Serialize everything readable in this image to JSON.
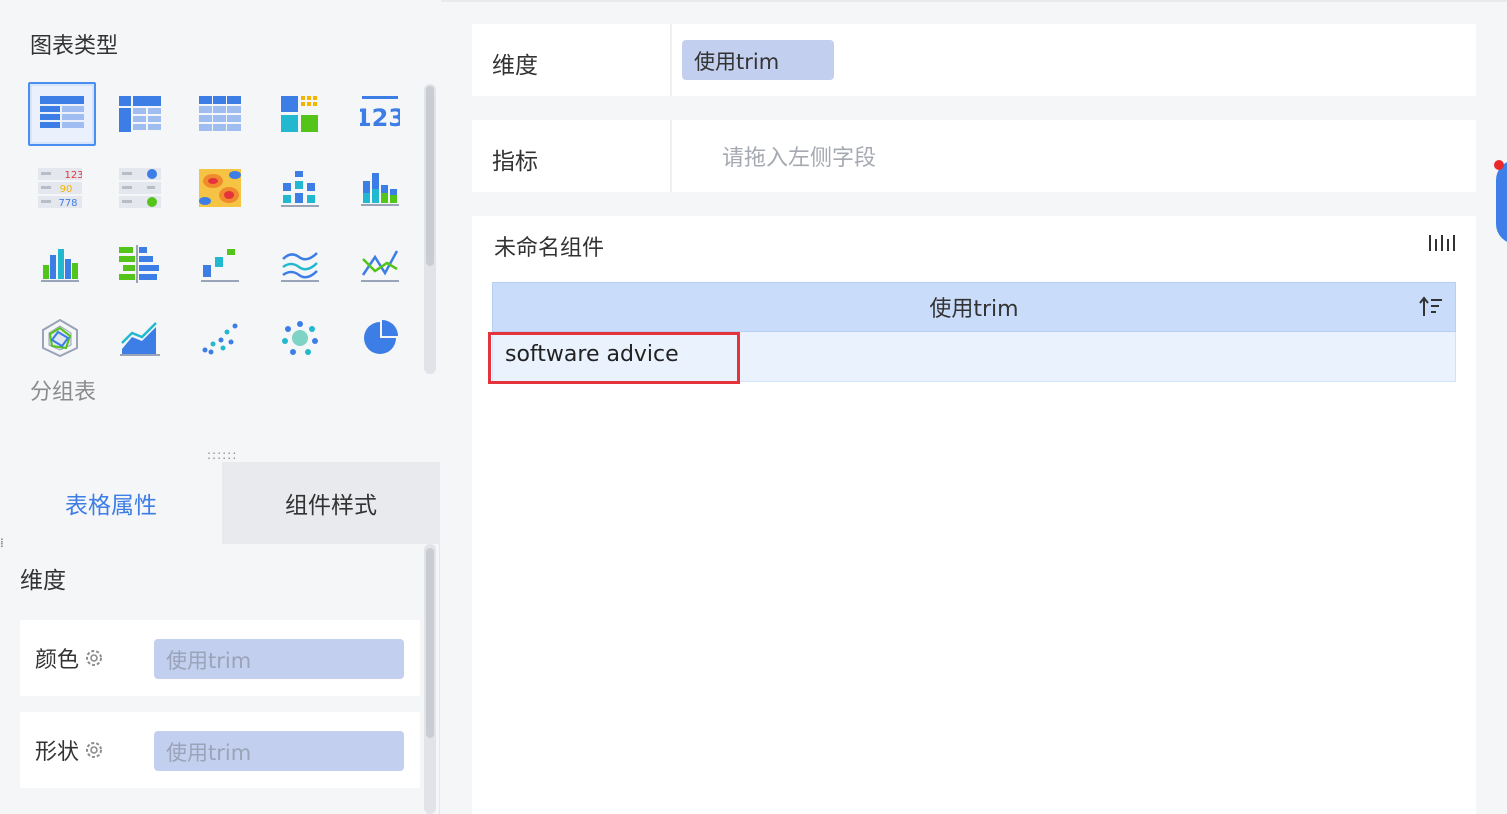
{
  "chart_types": {
    "title": "图表类型",
    "items": [
      {
        "icon": "table-icon",
        "selected": true
      },
      {
        "icon": "cross-table-icon"
      },
      {
        "icon": "detail-table-icon"
      },
      {
        "icon": "color-block-icon"
      },
      {
        "icon": "kpi-number-icon",
        "text": "123"
      },
      {
        "icon": "kpi-multi-icon",
        "values": [
          "123",
          "90",
          "778"
        ]
      },
      {
        "icon": "kpi-dot-icon"
      },
      {
        "icon": "heatmap-icon"
      },
      {
        "icon": "range-bar-icon"
      },
      {
        "icon": "stacked-bar-icon"
      },
      {
        "icon": "grouped-bar-icon"
      },
      {
        "icon": "horizontal-bar-icon"
      },
      {
        "icon": "waterfall-icon"
      },
      {
        "icon": "line-area-icon"
      },
      {
        "icon": "line-combo-icon"
      },
      {
        "icon": "radar-icon"
      },
      {
        "icon": "area-line-icon"
      },
      {
        "icon": "scatter-icon"
      },
      {
        "icon": "bubble-icon"
      },
      {
        "icon": "pie-icon"
      }
    ],
    "selected_label": "分组表",
    "grip": "::::::"
  },
  "tabs": {
    "table_props": "表格属性",
    "component_style": "组件样式"
  },
  "props": {
    "section_title": "维度",
    "color_label": "颜色",
    "color_value": "使用trim",
    "shape_label": "形状",
    "shape_value": "使用trim"
  },
  "fields": {
    "dimension_label": "维度",
    "dimension_value": "使用trim",
    "metric_label": "指标",
    "metric_placeholder": "请拖入左侧字段"
  },
  "component": {
    "title": "未命名组件",
    "column_header": "使用trim",
    "rows": [
      "software advice"
    ]
  },
  "colors": {
    "accent": "#3c7de6",
    "highlight": "#e5333b",
    "pill": "#c3cfef",
    "header": "#c9dcf9"
  }
}
